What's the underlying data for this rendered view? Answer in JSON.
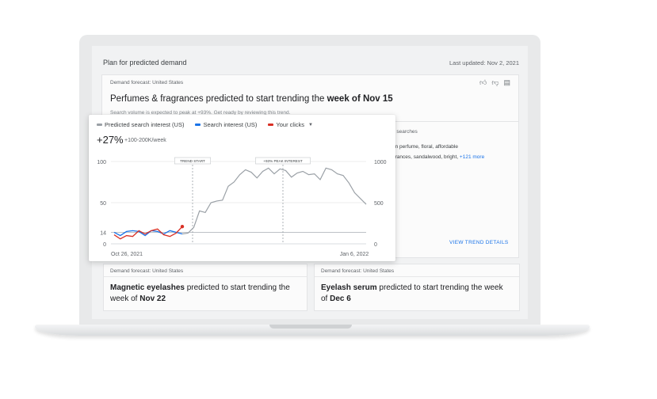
{
  "header": {
    "title": "Plan for predicted demand",
    "last_updated": "Last updated: Nov 2, 2021"
  },
  "main_card": {
    "label": "Demand forecast: United States",
    "headline_category": "Perfumes & fragrances",
    "headline_mid": " predicted to start trending the ",
    "headline_week": "week of Nov 15",
    "subtext": "Search volume is expected to peak at +93%. Get ready by reviewing this trend.",
    "top_searches_label": "p searches",
    "search_line1": "an perfume, floral, affordable",
    "search_line2": "grances, sandalwood, bright, ",
    "more_link": "+121 more",
    "view_details": "VIEW TREND DETAILS",
    "feedback_icons": [
      "thumbs-up-icon",
      "thumbs-down-icon",
      "comment-icon"
    ]
  },
  "chart_card": {
    "legend": [
      {
        "label": "Predicted search interest (US)",
        "color": "#9aa0a6"
      },
      {
        "label": "Search interest (US)",
        "color": "#1a73e8"
      },
      {
        "label": "Your clicks",
        "color": "#d93025"
      }
    ],
    "change_pct": "+27%",
    "weekly_range": "+100-200K/week"
  },
  "chart_data": {
    "type": "line",
    "x_start_label": "Oct 26, 2021",
    "x_end_label": "Jan 6, 2022",
    "y_left_ticks": [
      "100",
      "50",
      "14",
      "0"
    ],
    "y_right_ticks": [
      "1000",
      "500",
      "0"
    ],
    "y_left_range": [
      0,
      100
    ],
    "y_right_range": [
      0,
      1000
    ],
    "annotations": [
      "TREND START",
      "+93% PEAK INTEREST"
    ],
    "reference_level": 14,
    "series": [
      {
        "name": "Search interest (US)",
        "color": "#1a73e8",
        "values": [
          14,
          10,
          15,
          16,
          15,
          10,
          16,
          15,
          12,
          16,
          14,
          12
        ]
      },
      {
        "name": "Your clicks",
        "color": "#d93025",
        "values": [
          11,
          6,
          10,
          9,
          16,
          12,
          16,
          18,
          11,
          9,
          13,
          21
        ]
      },
      {
        "name": "Predicted search interest (US)",
        "color": "#9aa0a6",
        "values": [
          12,
          13,
          20,
          40,
          38,
          50,
          52,
          53,
          70,
          75,
          84,
          90,
          87,
          80,
          88,
          92,
          85,
          91,
          89,
          81,
          86,
          88,
          84,
          85,
          78,
          92,
          90,
          85,
          83,
          74,
          62,
          55,
          48
        ]
      }
    ],
    "grid": true
  },
  "bottom_cards": [
    {
      "label": "Demand forecast: United States",
      "category": "Magnetic eyelashes",
      "mid": " predicted to start trending the week of ",
      "week": "Nov 22"
    },
    {
      "label": "Demand forecast: United States",
      "category": "Eyelash serum",
      "mid": " predicted to start trending the week of ",
      "week": "Dec 6"
    }
  ]
}
